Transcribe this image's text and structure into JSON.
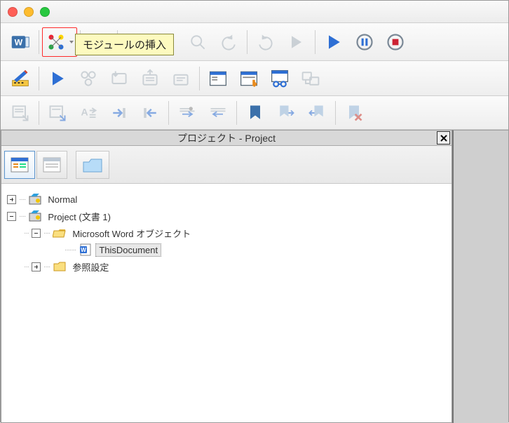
{
  "window": {
    "os": "mac"
  },
  "tooltip": {
    "insert_module": "モジュールの挿入"
  },
  "project_panel": {
    "title": "プロジェクト - Project"
  },
  "tree": {
    "normal": "Normal",
    "project": "Project (文書 1)",
    "objects_folder": "Microsoft Word オブジェクト",
    "this_document": "ThisDocument",
    "references": "参照設定"
  }
}
